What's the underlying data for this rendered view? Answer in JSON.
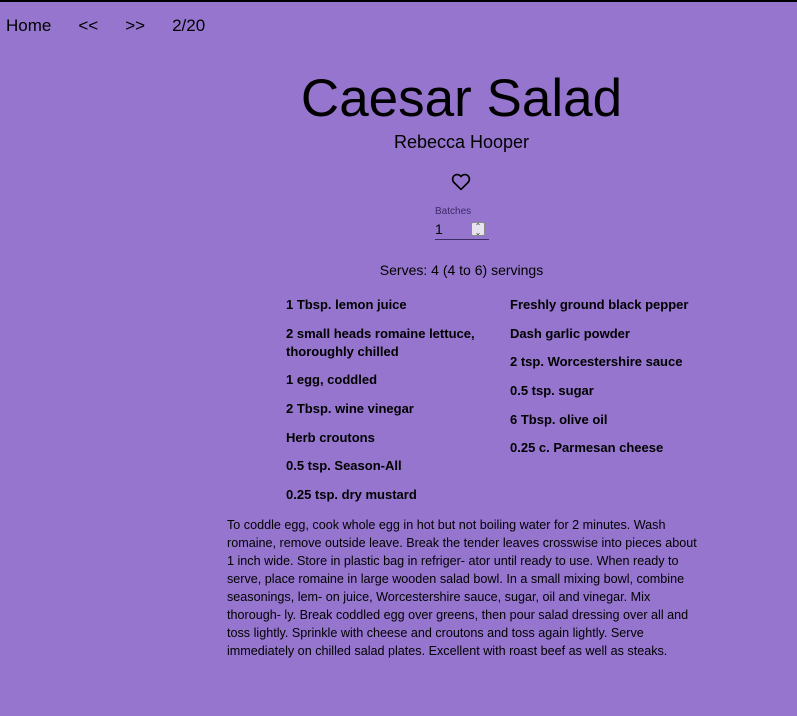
{
  "nav": {
    "home": "Home",
    "prev": "<<",
    "next": ">>",
    "page": "2/20"
  },
  "recipe": {
    "title": "Caesar Salad",
    "author": "Rebecca Hooper",
    "favorite_icon": "heart-outline-icon",
    "batches_label": "Batches",
    "batches_value": "1",
    "serves": "Serves: 4 (4 to 6) servings",
    "ingredients_left": [
      "1 Tbsp. lemon juice",
      "2 small heads romaine lettuce, thoroughly chilled",
      "1 egg, coddled",
      "2 Tbsp. wine vinegar",
      "Herb croutons",
      "0.5 tsp. Season-All",
      "0.25 tsp. dry mustard"
    ],
    "ingredients_right": [
      "Freshly ground black pepper",
      "Dash garlic powder",
      "2 tsp. Worcestershire sauce",
      "0.5 tsp. sugar",
      "6 Tbsp. olive oil",
      "0.25 c. Parmesan cheese"
    ],
    "directions": "To coddle egg, cook whole egg in hot but not boiling water for 2 minutes. Wash romaine, remove outside leave. Break the tender leaves crosswise into pieces about 1 inch wide. Store in plastic bag in refriger- ator until ready to use. When ready to serve, place romaine in large wooden salad bowl. In a small mixing bowl, combine seasonings, lem- on juice, Worcestershire sauce, sugar, oil and vinegar. Mix thorough- ly. Break coddled egg over greens, then pour salad dressing over all and toss lightly. Sprinkle with cheese and croutons and toss again lightly. Serve immediately on chilled salad plates. Excellent with roast beef as well as steaks."
  },
  "colors": {
    "background": "#9575cd",
    "text": "#000000"
  }
}
